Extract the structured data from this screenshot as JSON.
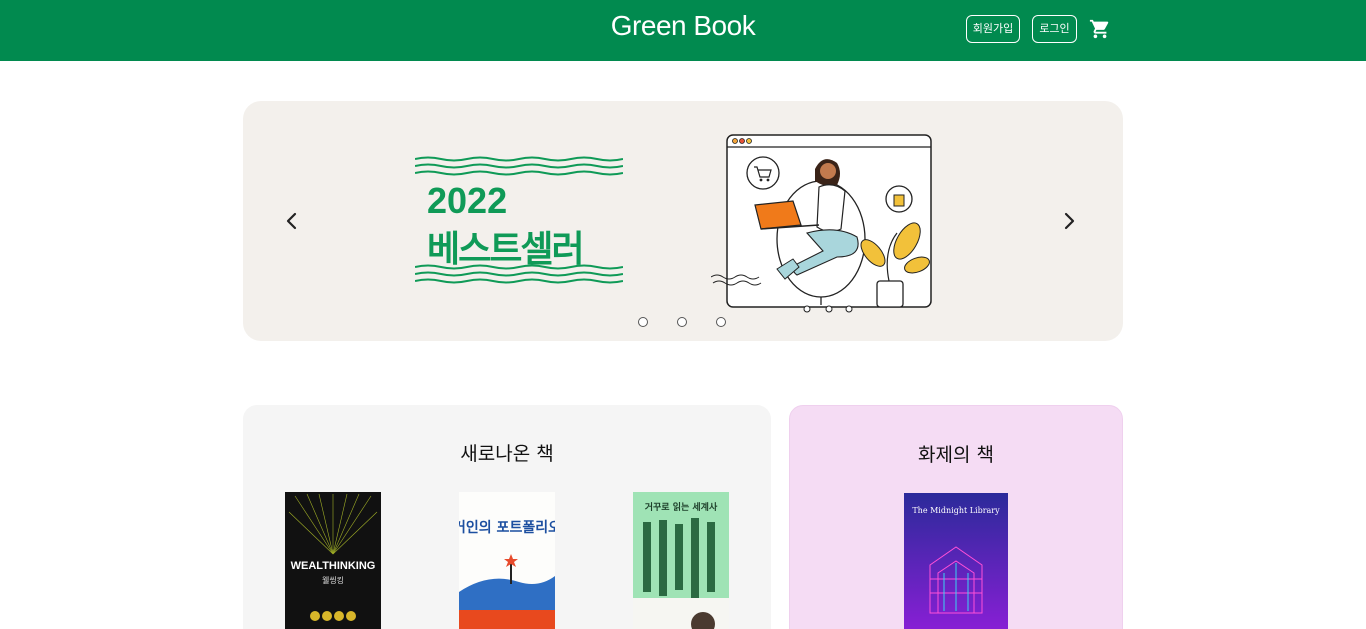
{
  "header": {
    "logo": "Green Book",
    "signup_label": "회원가입",
    "login_label": "로그인",
    "cart_icon": "cart-icon",
    "bg_color": "#018a4f"
  },
  "banner": {
    "year": "2022",
    "title": "베스트셀러",
    "accent_color": "#0f9a57",
    "bg_color": "#f3f0ec",
    "slide_count": 3
  },
  "sections": {
    "new_books": {
      "title": "새로나온 책",
      "books": [
        {
          "title": "WEALTHINKING",
          "subtitle": "웰씽킹"
        },
        {
          "title": "거인의 포트폴리오"
        },
        {
          "title": "거꾸로 읽는 세계사"
        }
      ]
    },
    "hot_books": {
      "title": "화제의 책",
      "books": [
        {
          "title": "The Midnight Library"
        }
      ]
    }
  }
}
